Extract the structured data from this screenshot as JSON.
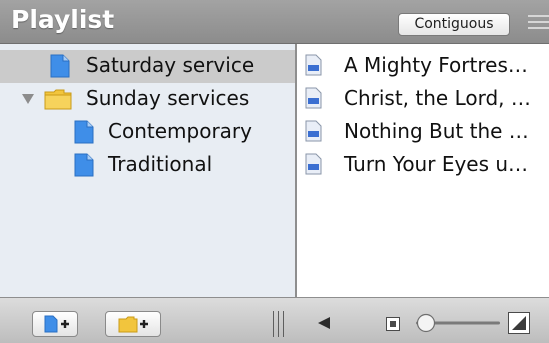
{
  "header": {
    "title": "Playlist",
    "mode_button": "Contiguous"
  },
  "tree": {
    "items": [
      {
        "label": "Saturday service",
        "type": "document",
        "selected": true
      },
      {
        "label": "Sunday services",
        "type": "folder",
        "expanded": true
      },
      {
        "label": "Contemporary",
        "type": "document"
      },
      {
        "label": "Traditional",
        "type": "document"
      }
    ]
  },
  "songs": {
    "items": [
      {
        "label": "A Mighty Fortres…"
      },
      {
        "label": "Christ, the Lord, …"
      },
      {
        "label": "Nothing But the …"
      },
      {
        "label": "Turn Your Eyes u…"
      }
    ]
  },
  "colors": {
    "header_bg": "#999999",
    "sidebar_bg": "#e8edf3",
    "selection_bg": "#cbcbcb",
    "doc_icon": "#3f8ee8",
    "folder_icon": "#f2c53d"
  },
  "icons": {
    "add_document": "add-document-icon",
    "add_folder": "add-folder-icon",
    "previous": "previous-arrow-icon",
    "zoom_out": "zoom-small-icon",
    "zoom_in": "zoom-large-icon"
  },
  "zoom": {
    "level": 0.1
  }
}
